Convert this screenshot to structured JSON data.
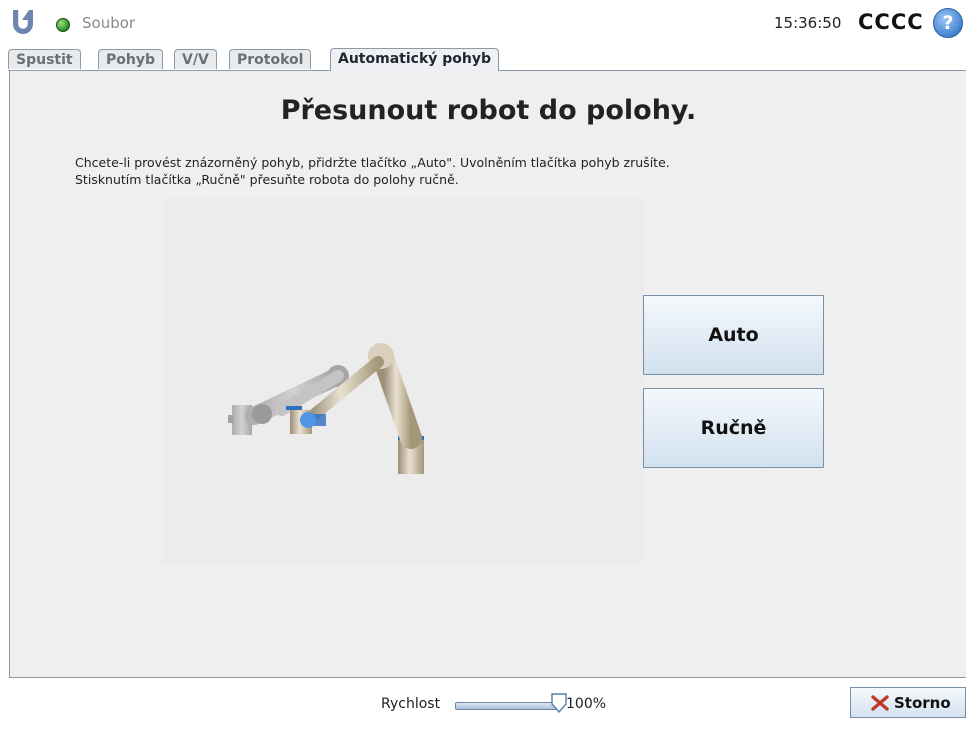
{
  "header": {
    "menu_label": "Soubor",
    "time": "15:36:50",
    "robot_name": "CCCC",
    "help_symbol": "?"
  },
  "tabs": [
    {
      "label": "Spustit",
      "active": false
    },
    {
      "label": "Pohyb",
      "active": false
    },
    {
      "label": "V/V",
      "active": false
    },
    {
      "label": "Protokol",
      "active": false
    },
    {
      "label": "Automatický pohyb",
      "active": true
    }
  ],
  "main": {
    "title": "Přesunout robot do polohy.",
    "instruction_line1": "Chcete-li provést znázorněný pohyb, přidržte tlačítko „Auto\". Uvolněním tlačítka pohyb zrušíte.",
    "instruction_line2": "Stisknutím tlačítka „Ručně\" přesuňte robota do polohy ručně.",
    "auto_label": "Auto",
    "manual_label": "Ručně"
  },
  "footer": {
    "speed_label": "Rychlost",
    "speed_value": "100%",
    "speed_fraction": 1.0,
    "cancel_label": "Storno"
  },
  "colors": {
    "status_ok": "#2e8b2a",
    "accent_blue": "#3f7fd0",
    "cancel_icon": "#c0392b",
    "robot_joint_ring": "#2f6fc2"
  },
  "icons": {
    "logo": "universal-robots-logo",
    "status": "status-led-green",
    "help": "help-icon",
    "cancel": "x-icon"
  }
}
